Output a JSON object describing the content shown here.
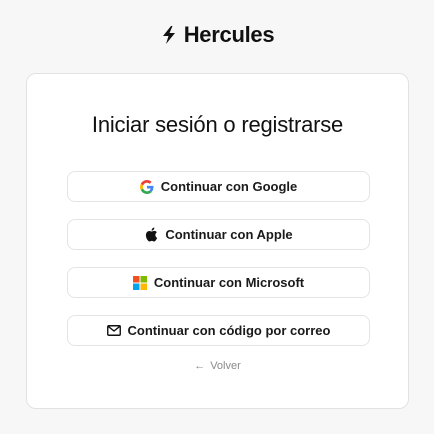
{
  "brand": {
    "name": "Hercules",
    "icon": "lightning-bolt-icon"
  },
  "card": {
    "title": "Iniciar sesión o registrarse",
    "buttons": {
      "google": {
        "label": "Continuar con Google",
        "icon": "google-icon"
      },
      "apple": {
        "label": "Continuar con Apple",
        "icon": "apple-icon"
      },
      "microsoft": {
        "label": "Continuar con Microsoft",
        "icon": "microsoft-icon"
      },
      "email": {
        "label": "Continuar con código por correo",
        "icon": "mail-icon"
      }
    },
    "back": {
      "label": "Volver",
      "icon": "arrow-left-icon"
    }
  },
  "colors": {
    "background": "#f7f7f7",
    "card": "#ffffff",
    "border": "#e2e2e2",
    "text": "#111111",
    "muted": "#8a8a8a",
    "google_blue": "#4285F4",
    "google_red": "#EA4335",
    "google_yellow": "#FBBC05",
    "google_green": "#34A853",
    "ms_red": "#F25022",
    "ms_green": "#7FBA00",
    "ms_blue": "#00A4EF",
    "ms_yellow": "#FFB900"
  }
}
